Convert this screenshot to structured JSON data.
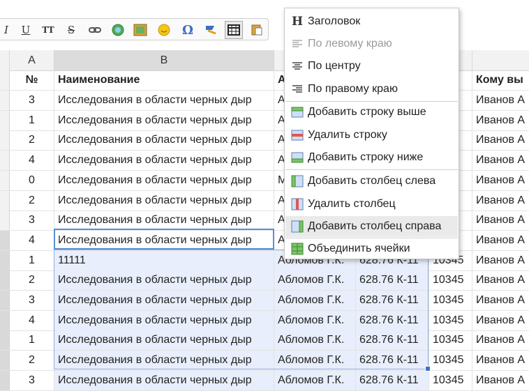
{
  "toolbar": {
    "buttons": [
      {
        "name": "italic-button",
        "label": "I",
        "icon": "italic-icon"
      },
      {
        "name": "underline-button",
        "label": "U",
        "icon": "underline-icon"
      },
      {
        "name": "teletype-button",
        "label": "TT",
        "icon": "teletype-icon"
      },
      {
        "name": "strikethrough-button",
        "label": "S",
        "icon": "strikethrough-icon"
      },
      {
        "name": "link-button",
        "label": "",
        "icon": "link-icon"
      },
      {
        "name": "insert-media-button",
        "label": "",
        "icon": "globe-icon"
      },
      {
        "name": "insert-image-button",
        "label": "",
        "icon": "image-icon"
      },
      {
        "name": "insert-emoticon-button",
        "label": "",
        "icon": "smiley-icon"
      },
      {
        "name": "special-char-button",
        "label": "Ω",
        "icon": "omega-icon"
      },
      {
        "name": "remove-format-button",
        "label": "",
        "icon": "eraser-icon"
      },
      {
        "name": "table-button",
        "label": "",
        "icon": "table-icon"
      },
      {
        "name": "paste-button",
        "label": "",
        "icon": "paste-icon"
      }
    ]
  },
  "columns": {
    "A": "A",
    "B": "B"
  },
  "header_row": {
    "num": "№",
    "name": "Наименование",
    "author": "А",
    "recipient": "Кому вы"
  },
  "rows": [
    {
      "num": "3",
      "name": "Исследования в области черных дыр",
      "author": "А",
      "code": "",
      "id": "",
      "to": "Иванов А"
    },
    {
      "num": "1",
      "name": "Исследования в области черных дыр",
      "author": "А",
      "code": "",
      "id": "",
      "to": "Иванов А"
    },
    {
      "num": "2",
      "name": "Исследования в области черных дыр",
      "author": "А",
      "code": "",
      "id": "",
      "to": "Иванов А"
    },
    {
      "num": "4",
      "name": "Исследования в области черных дыр",
      "author": "А",
      "code": "",
      "id": "",
      "to": "Иванов А"
    },
    {
      "num": "0",
      "name": "Исследования в области черных дыр",
      "author": "М",
      "code": "",
      "id": "",
      "to": "Иванов А"
    },
    {
      "num": "2",
      "name": "Исследования в области черных дыр",
      "author": "А",
      "code": "",
      "id": "",
      "to": "Иванов А"
    },
    {
      "num": "3",
      "name": "Исследования в области черных дыр",
      "author": "А",
      "code": "",
      "id": "",
      "to": "Иванов А"
    },
    {
      "num": "4",
      "name": "Исследования в области черных дыр",
      "author": "А",
      "code": "",
      "id": "",
      "to": "Иванов А"
    },
    {
      "num": "1",
      "name": "11111",
      "author": "Абломов Г.К.",
      "code": "628.76 К-11",
      "id": "10345",
      "to": "Иванов А"
    },
    {
      "num": "2",
      "name": "Исследования в области черных дыр",
      "author": "Абломов Г.К.",
      "code": "628.76 К-11",
      "id": "10345",
      "to": "Иванов А"
    },
    {
      "num": "3",
      "name": "Исследования в области черных дыр",
      "author": "Абломов Г.К.",
      "code": "628.76 К-11",
      "id": "10345",
      "to": "Иванов А"
    },
    {
      "num": "4",
      "name": "Исследования в области черных дыр",
      "author": "Абломов Г.К.",
      "code": "628.76 К-11",
      "id": "10345",
      "to": "Иванов А"
    },
    {
      "num": "1",
      "name": "Исследования в области черных дыр",
      "author": "Абломов Г.К.",
      "code": "628.76 К-11",
      "id": "10345",
      "to": "Иванов А"
    },
    {
      "num": "2",
      "name": "Исследования в области черных дыр",
      "author": "Абломов Г.К.",
      "code": "628.76 К-11",
      "id": "10345",
      "to": "Иванов А"
    },
    {
      "num": "3",
      "name": "Исследования в области черных дыр",
      "author": "Абломов Г.К.",
      "code": "628.76 К-11",
      "id": "10345",
      "to": "Иванов А"
    }
  ],
  "context_menu": {
    "items": [
      {
        "label": "Заголовок",
        "icon": "heading-icon",
        "disabled": false
      },
      {
        "label": "По левому краю",
        "icon": "align-left-icon",
        "disabled": true
      },
      {
        "label": "По центру",
        "icon": "align-center-icon",
        "disabled": false
      },
      {
        "label": "По правому краю",
        "icon": "align-right-icon",
        "disabled": false
      },
      {
        "label": "Добавить строку выше",
        "icon": "row-insert-above-icon",
        "disabled": false
      },
      {
        "label": "Удалить строку",
        "icon": "row-delete-icon",
        "disabled": false
      },
      {
        "label": "Добавить строку ниже",
        "icon": "row-insert-below-icon",
        "disabled": false
      },
      {
        "label": "Добавить столбец слева",
        "icon": "column-insert-left-icon",
        "disabled": false
      },
      {
        "label": "Удалить столбец",
        "icon": "column-delete-icon",
        "disabled": false
      },
      {
        "label": "Добавить столбец справа",
        "icon": "column-insert-right-icon",
        "disabled": false,
        "highlighted": true
      },
      {
        "label": "Объединить ячейки",
        "icon": "merge-cells-icon",
        "disabled": false
      }
    ]
  },
  "colors": {
    "selection": "#e8eefb",
    "active_border": "#5a8fd6",
    "menu_highlight": "#eaeaea"
  }
}
